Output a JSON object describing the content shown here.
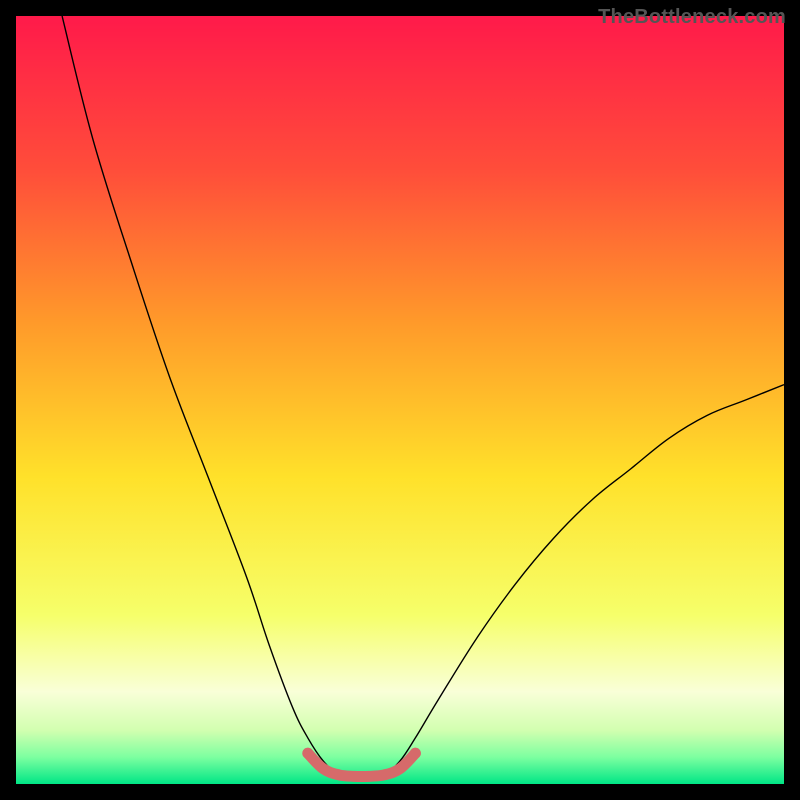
{
  "watermark": "TheBottleneck.com",
  "chart_data": {
    "type": "line",
    "title": "",
    "xlabel": "",
    "ylabel": "",
    "xlim": [
      0,
      100
    ],
    "ylim": [
      0,
      100
    ],
    "grid": false,
    "legend": false,
    "background_gradient": {
      "stops": [
        {
          "offset": 0.0,
          "color": "#ff1a4a"
        },
        {
          "offset": 0.2,
          "color": "#ff4d3a"
        },
        {
          "offset": 0.4,
          "color": "#ff9a2a"
        },
        {
          "offset": 0.6,
          "color": "#ffe12a"
        },
        {
          "offset": 0.78,
          "color": "#f6ff6a"
        },
        {
          "offset": 0.88,
          "color": "#f9ffd8"
        },
        {
          "offset": 0.93,
          "color": "#d2ffb0"
        },
        {
          "offset": 0.965,
          "color": "#7dffa0"
        },
        {
          "offset": 1.0,
          "color": "#00e686"
        }
      ]
    },
    "series": [
      {
        "name": "bottleneck-curve",
        "color": "#000000",
        "stroke_width": 1.4,
        "points": [
          {
            "x": 6,
            "y": 100
          },
          {
            "x": 10,
            "y": 84
          },
          {
            "x": 15,
            "y": 68
          },
          {
            "x": 20,
            "y": 53
          },
          {
            "x": 25,
            "y": 40
          },
          {
            "x": 30,
            "y": 27
          },
          {
            "x": 33,
            "y": 18
          },
          {
            "x": 36,
            "y": 10
          },
          {
            "x": 38,
            "y": 6
          },
          {
            "x": 40,
            "y": 3
          },
          {
            "x": 42,
            "y": 1.2
          },
          {
            "x": 44,
            "y": 0.8
          },
          {
            "x": 46,
            "y": 0.8
          },
          {
            "x": 48,
            "y": 1.2
          },
          {
            "x": 50,
            "y": 3
          },
          {
            "x": 52,
            "y": 6
          },
          {
            "x": 55,
            "y": 11
          },
          {
            "x": 60,
            "y": 19
          },
          {
            "x": 65,
            "y": 26
          },
          {
            "x": 70,
            "y": 32
          },
          {
            "x": 75,
            "y": 37
          },
          {
            "x": 80,
            "y": 41
          },
          {
            "x": 85,
            "y": 45
          },
          {
            "x": 90,
            "y": 48
          },
          {
            "x": 95,
            "y": 50
          },
          {
            "x": 100,
            "y": 52
          }
        ]
      },
      {
        "name": "optimal-zone-highlight",
        "color": "#d66a6a",
        "stroke_width": 11,
        "linecap": "round",
        "points": [
          {
            "x": 38,
            "y": 4.0
          },
          {
            "x": 40,
            "y": 2.0
          },
          {
            "x": 42,
            "y": 1.2
          },
          {
            "x": 44,
            "y": 1.0
          },
          {
            "x": 46,
            "y": 1.0
          },
          {
            "x": 48,
            "y": 1.2
          },
          {
            "x": 50,
            "y": 2.0
          },
          {
            "x": 52,
            "y": 4.0
          }
        ]
      }
    ]
  }
}
